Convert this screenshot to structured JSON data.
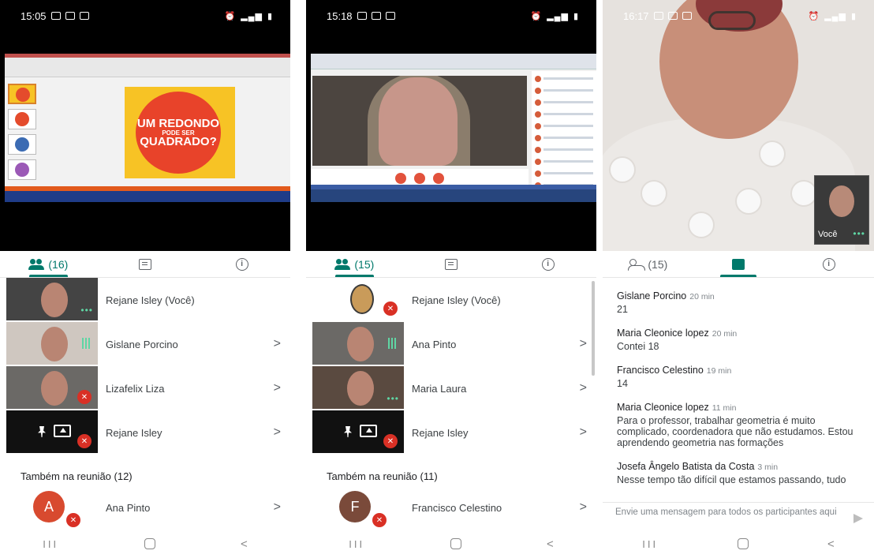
{
  "phone1": {
    "status_time": "15:05",
    "slide_title_small": "UM REDONDO",
    "slide_title_big1": "PODE SER",
    "slide_title_big2": "QUADRADO?",
    "tabs": {
      "people_count": "(16)"
    },
    "participants": [
      {
        "name": "Rejane Isley (Você)"
      },
      {
        "name": "Gislane Porcino"
      },
      {
        "name": "Lizafelix Liza"
      },
      {
        "name": "Rejane Isley"
      }
    ],
    "also_in_meeting": "Também na reunião (12)",
    "others": [
      {
        "initial": "A",
        "name": "Ana Pinto",
        "color": "#d84a2f"
      }
    ]
  },
  "phone2": {
    "status_time": "15:18",
    "tabs": {
      "people_count": "(15)"
    },
    "participants": [
      {
        "name": "Rejane Isley (Você)"
      },
      {
        "name": "Ana Pinto"
      },
      {
        "name": "Maria Laura"
      },
      {
        "name": "Rejane Isley"
      }
    ],
    "also_in_meeting": "Também na reunião (11)",
    "others": [
      {
        "initial": "F",
        "name": "Francisco Celestino",
        "color": "#7a4a3a"
      }
    ]
  },
  "phone3": {
    "status_time": "16:17",
    "self_label": "Você",
    "tabs": {
      "people_count": "(15)"
    },
    "messages": [
      {
        "author": "Gislane Porcino",
        "time": "20 min",
        "text": "21"
      },
      {
        "author": "Maria Cleonice lopez",
        "time": "20 min",
        "text": "Contei 18"
      },
      {
        "author": "Francisco Celestino",
        "time": "19 min",
        "text": "14"
      },
      {
        "author": "Maria Cleonice lopez",
        "time": "11 min",
        "text": "Para o professor, trabalhar geometria é muito complicado, coordenadora que não estudamos. Estou aprendendo geometria nas formações"
      },
      {
        "author": "Josefa Ângelo Batista da Costa",
        "time": "3 min",
        "text": "Nesse tempo tão difícil que estamos passando, tudo"
      }
    ],
    "composer_placeholder": "Envie uma mensagem para todos os participantes aqui"
  },
  "colors": {
    "accent": "#00796b",
    "mute_red": "#d93025"
  },
  "nav": {
    "recent": "III",
    "back": "<"
  }
}
